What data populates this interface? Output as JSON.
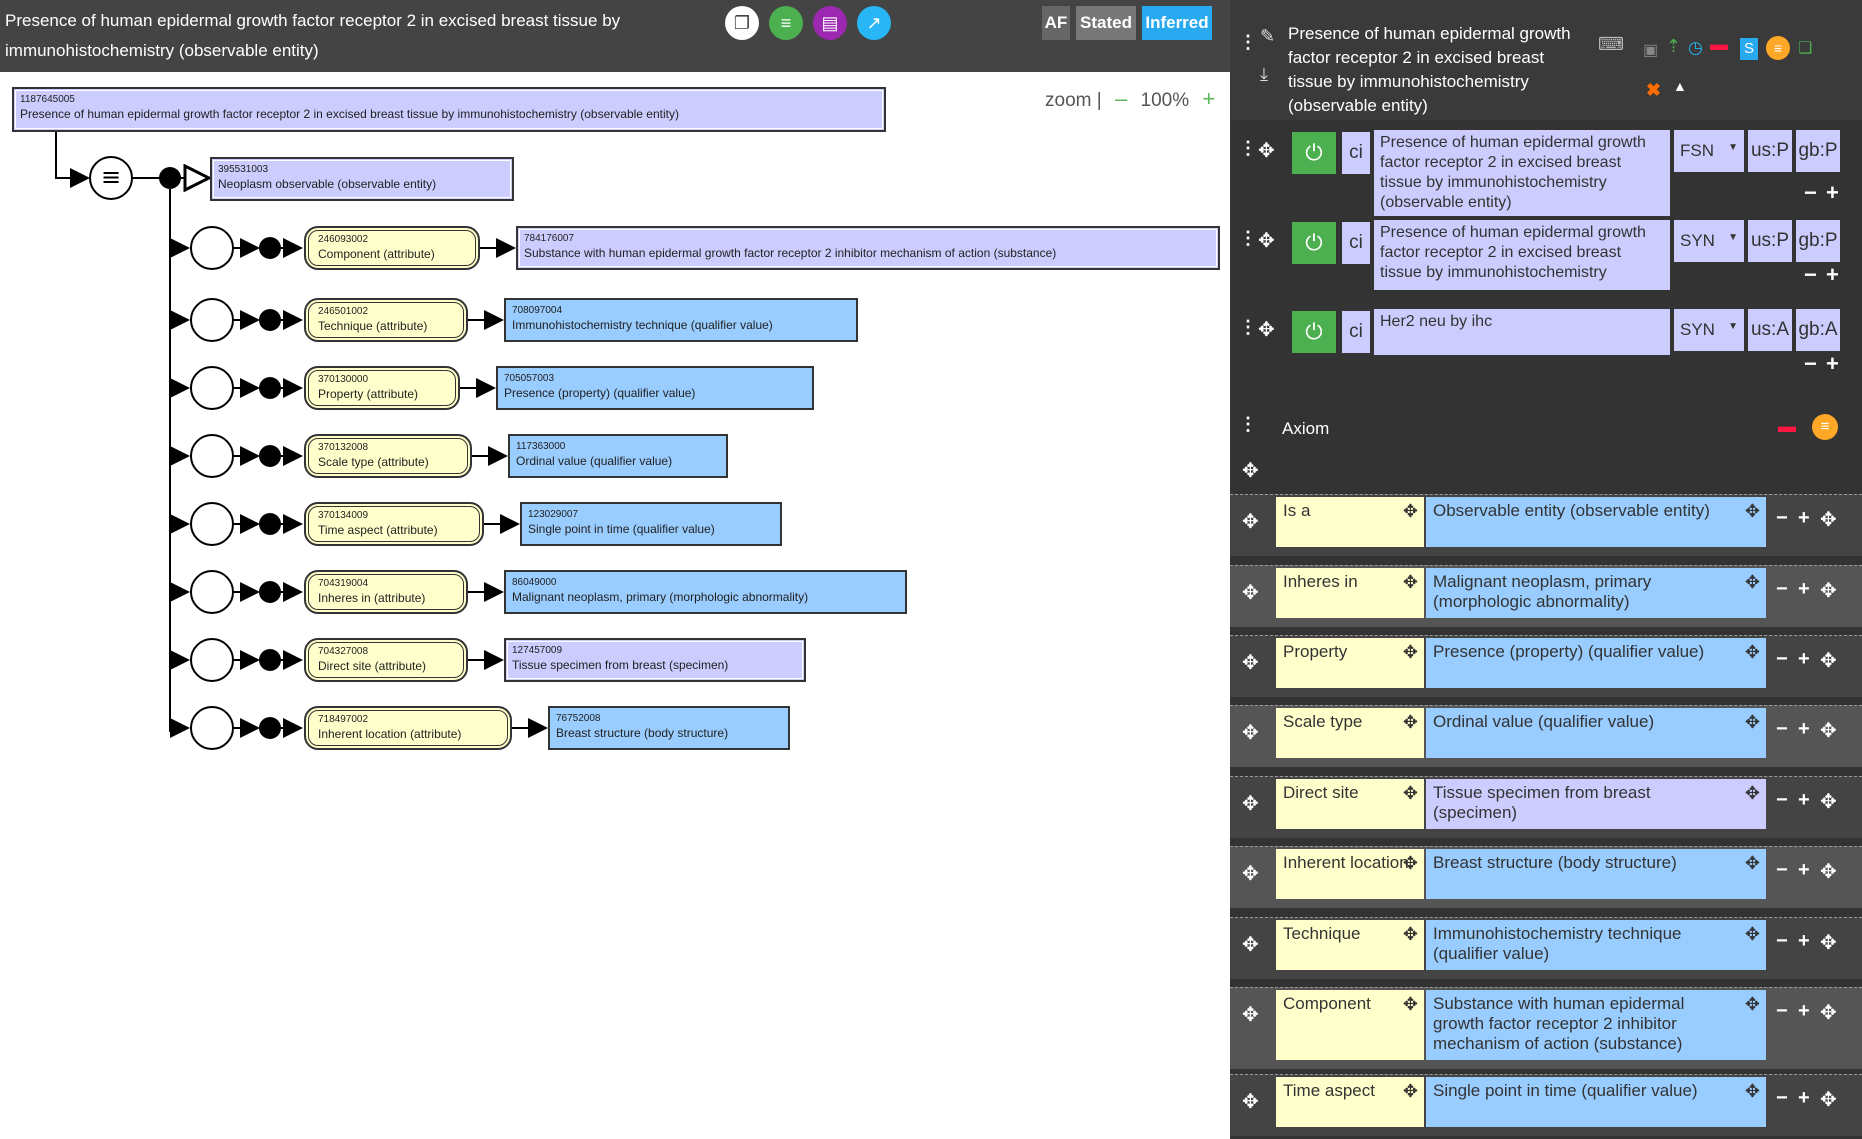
{
  "left": {
    "title": "Presence of human epidermal growth factor receptor 2 in excised breast tissue by immunohistochemistry (observable entity)",
    "buttons": {
      "af": "AF",
      "stated": "Stated",
      "inferred": "Inferred"
    },
    "zoom": {
      "label": "zoom |",
      "minus": "–",
      "value": "100%",
      "plus": "+"
    }
  },
  "diagram": {
    "root": {
      "id": "1187645005",
      "label": "Presence of human epidermal growth factor receptor 2 in excised breast tissue by immunohistochemistry (observable entity)"
    },
    "parent": {
      "id": "395531003",
      "label": "Neoplasm observable (observable entity)"
    },
    "groups": [
      {
        "attr_id": "246093002",
        "attr": "Component (attribute)",
        "val_id": "784176007",
        "val": "Substance with human epidermal growth factor receptor 2 inhibitor mechanism of action (substance)"
      },
      {
        "attr_id": "246501002",
        "attr": "Technique (attribute)",
        "val_id": "708097004",
        "val": "Immunohistochemistry technique (qualifier value)"
      },
      {
        "attr_id": "370130000",
        "attr": "Property (attribute)",
        "val_id": "705057003",
        "val": "Presence (property) (qualifier value)"
      },
      {
        "attr_id": "370132008",
        "attr": "Scale type (attribute)",
        "val_id": "117363000",
        "val": "Ordinal value (qualifier value)"
      },
      {
        "attr_id": "370134009",
        "attr": "Time aspect (attribute)",
        "val_id": "123029007",
        "val": "Single point in time (qualifier value)"
      },
      {
        "attr_id": "704319004",
        "attr": "Inheres in (attribute)",
        "val_id": "86049000",
        "val": "Malignant neoplasm, primary (morphologic abnormality)"
      },
      {
        "attr_id": "704327008",
        "attr": "Direct site (attribute)",
        "val_id": "127457009",
        "val": "Tissue specimen from breast (specimen)"
      },
      {
        "attr_id": "718497002",
        "attr": "Inherent location (attribute)",
        "val_id": "76752008",
        "val": "Breast structure (body structure)"
      }
    ]
  },
  "right": {
    "title": "Presence of human epidermal growth factor receptor 2 in excised breast tissue by immunohistochemistry (observable entity)",
    "s_label": "S",
    "descriptions": [
      {
        "ci": "ci",
        "term": "Presence of human epidermal growth factor receptor 2 in excised breast tissue by immunohistochemistry (observable entity)",
        "type": "FSN",
        "us": "us:P",
        "gb": "gb:P"
      },
      {
        "ci": "ci",
        "term": "Presence of human epidermal growth factor receptor 2 in excised breast tissue by immunohistochemistry",
        "type": "SYN",
        "us": "us:P",
        "gb": "gb:P"
      },
      {
        "ci": "ci",
        "term": "Her2 neu by ihc",
        "type": "SYN",
        "us": "us:A",
        "gb": "gb:A"
      }
    ],
    "axiom": {
      "title": "Axiom",
      "rows": [
        {
          "name": "Is a",
          "value": "Observable entity (observable entity)",
          "defined": false
        },
        {
          "name": "Inheres in",
          "value": "Malignant neoplasm, primary (morphologic abnormality)",
          "defined": false
        },
        {
          "name": "Property",
          "value": "Presence (property) (qualifier value)",
          "defined": false
        },
        {
          "name": "Scale type",
          "value": "Ordinal value (qualifier value)",
          "defined": false
        },
        {
          "name": "Direct site",
          "value": "Tissue specimen from breast (specimen)",
          "defined": true
        },
        {
          "name": "Inherent location",
          "value": "Breast structure (body structure)",
          "defined": false
        },
        {
          "name": "Technique",
          "value": "Immunohistochemistry technique (qualifier value)",
          "defined": false
        },
        {
          "name": "Component",
          "value": "Substance with human epidermal growth factor receptor 2 inhibitor mechanism of action (substance)",
          "defined": false
        },
        {
          "name": "Time aspect",
          "value": "Single point in time (qualifier value)",
          "defined": false
        }
      ]
    }
  },
  "colors": {
    "header": "#444444",
    "concept": "#ccccff",
    "primitive": "#99ccff",
    "attribute": "#ffffcc",
    "green": "#4caf50",
    "blue": "#29b6f6",
    "purple": "#9c27b0",
    "orange": "#ffa726",
    "red": "#ff1744"
  }
}
